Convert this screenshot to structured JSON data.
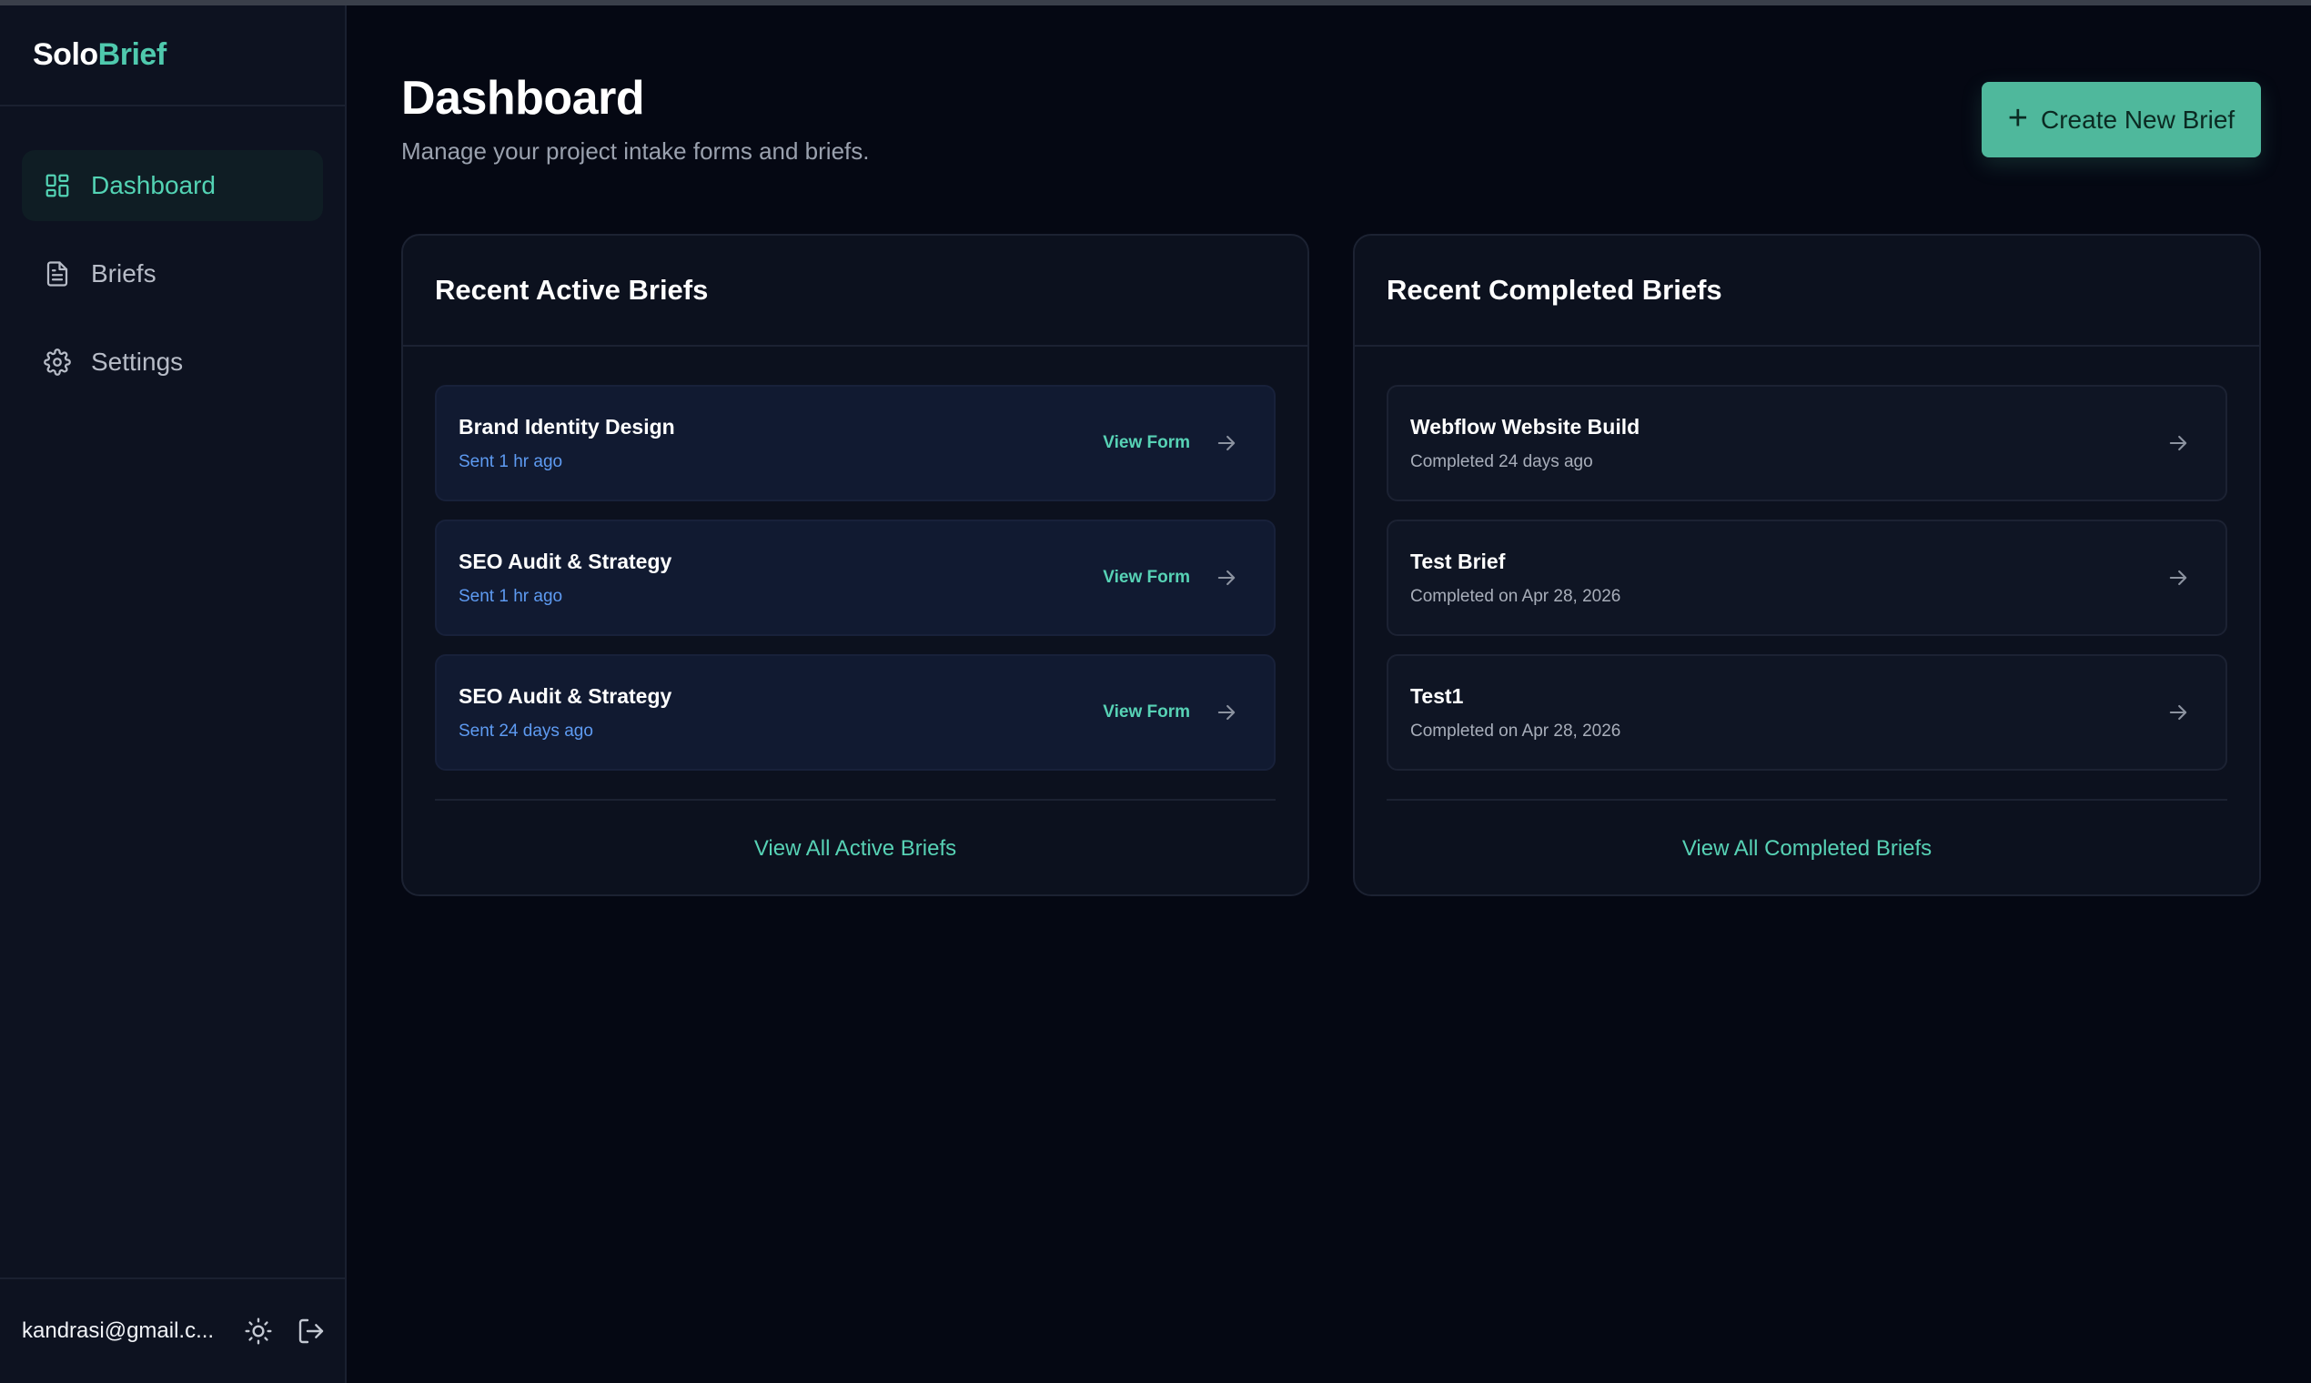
{
  "brand": {
    "part1": "Solo",
    "part2": "Brief"
  },
  "sidebar": {
    "items": [
      {
        "label": "Dashboard",
        "icon": "dashboard-grid-icon",
        "active": true
      },
      {
        "label": "Briefs",
        "icon": "document-icon",
        "active": false
      },
      {
        "label": "Settings",
        "icon": "gear-icon",
        "active": false
      }
    ],
    "user_email": "kandrasi@gmail.c...",
    "theme_icon": "sun-icon",
    "logout_icon": "logout-icon"
  },
  "header": {
    "title": "Dashboard",
    "subtitle": "Manage your project intake forms and briefs.",
    "create_button": "Create New Brief"
  },
  "active_briefs": {
    "title": "Recent Active Briefs",
    "items": [
      {
        "title": "Brand Identity Design",
        "status": "Sent 1 hr ago",
        "action": "View Form"
      },
      {
        "title": "SEO Audit & Strategy",
        "status": "Sent 1 hr ago",
        "action": "View Form"
      },
      {
        "title": "SEO Audit & Strategy",
        "status": "Sent 24 days ago",
        "action": "View Form"
      }
    ],
    "view_all": "View All Active Briefs"
  },
  "completed_briefs": {
    "title": "Recent Completed Briefs",
    "items": [
      {
        "title": "Webflow Website Build",
        "status": "Completed 24 days ago"
      },
      {
        "title": "Test Brief",
        "status": "Completed on Apr 28, 2026"
      },
      {
        "title": "Test1",
        "status": "Completed on Apr 28, 2026"
      }
    ],
    "view_all": "View All Completed Briefs"
  },
  "colors": {
    "accent": "#4fb89c",
    "accent_text": "#57d2b5",
    "background": "#050813",
    "sidebar": "#0d1220",
    "link_blue": "#5e9bf2"
  }
}
